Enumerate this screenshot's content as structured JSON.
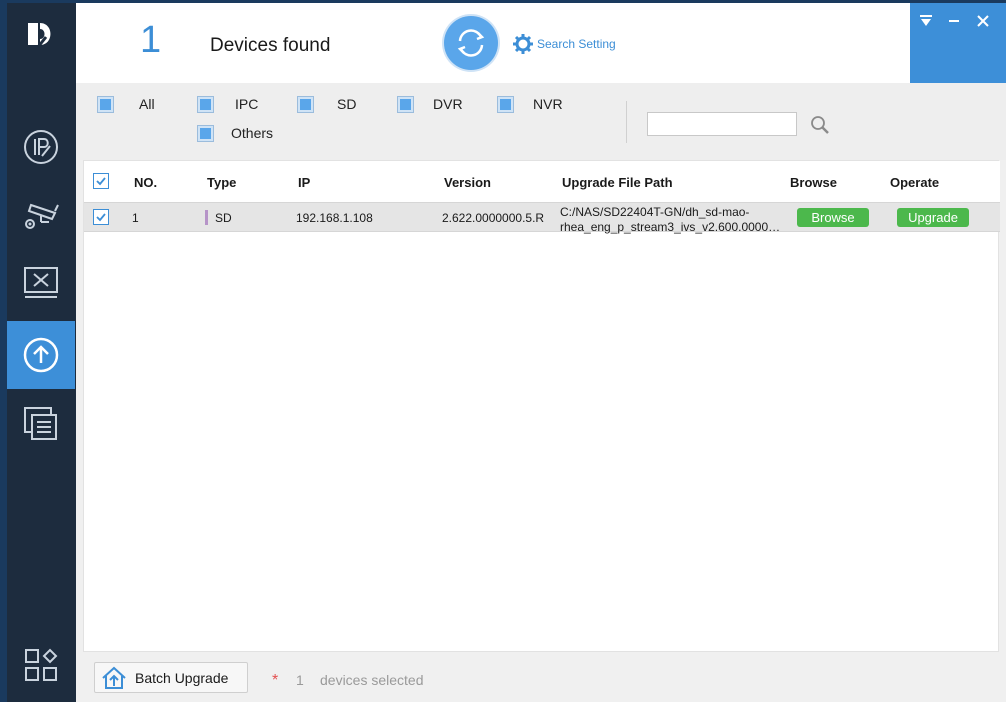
{
  "header": {
    "count": "1",
    "found_label": "Devices found",
    "search_setting": "Search Setting"
  },
  "filters": {
    "items": [
      {
        "label": "All"
      },
      {
        "label": "IPC"
      },
      {
        "label": "SD"
      },
      {
        "label": "DVR"
      },
      {
        "label": "NVR"
      },
      {
        "label": "Others"
      }
    ],
    "search_value": ""
  },
  "table": {
    "columns": [
      "NO.",
      "Type",
      "IP",
      "Version",
      "Upgrade File Path",
      "Browse",
      "Operate"
    ],
    "rows": [
      {
        "no": "1",
        "type": "SD",
        "ip": "192.168.1.108",
        "version": "2.622.0000000.5.R",
        "path_line1": "C:/NAS/SD22404T-GN/dh_sd-mao-",
        "path_line2": "rhea_eng_p_stream3_ivs_v2.600.0000000",
        "browse_label": "Browse",
        "operate_label": "Upgrade"
      }
    ]
  },
  "footer": {
    "batch_label": "Batch Upgrade",
    "star": "*",
    "selected_count": "1",
    "selected_label": "devices selected"
  },
  "colors": {
    "accent": "#3d8fd8",
    "sidebar": "#1d2c3e",
    "green": "#4cb84c"
  }
}
